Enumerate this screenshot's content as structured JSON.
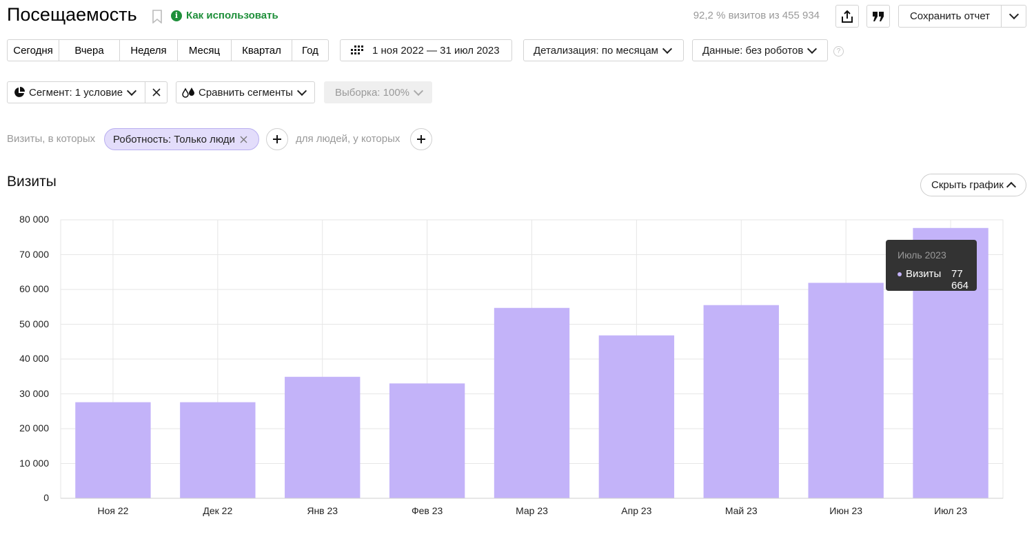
{
  "header": {
    "title": "Посещаемость",
    "help_link": "Как использовать",
    "visits_share": "92,2 % визитов из 455 934",
    "save_report": "Сохранить отчет"
  },
  "period_tabs": [
    "Сегодня",
    "Вчера",
    "Неделя",
    "Месяц",
    "Квартал",
    "Год"
  ],
  "date_range": "1 ноя 2022 — 31 июл 2023",
  "detail_dropdown": "Детализация: по месяцам",
  "data_dropdown": "Данные: без роботов",
  "segment": {
    "label": "Сегмент: 1 условие",
    "compare": "Сравнить сегменты",
    "sample": "Выборка: 100%"
  },
  "filters": {
    "visits_prefix": "Визиты, в которых",
    "chip": "Роботность: Только люди",
    "people_prefix": "для людей, у которых"
  },
  "chart_section": {
    "title": "Визиты",
    "hide_button": "Скрыть график"
  },
  "tooltip": {
    "period": "Июль 2023",
    "series": "Визиты",
    "value": "77 664"
  },
  "colors": {
    "bar": "#c3b3f9",
    "accent_green": "#1e8f3a",
    "tooltip_bg": "#333333"
  },
  "chart_data": {
    "type": "bar",
    "categories": [
      "Ноя 22",
      "Дек 22",
      "Янв 23",
      "Фев 23",
      "Мар 23",
      "Апр 23",
      "Май 23",
      "Июн 23",
      "Июл 23"
    ],
    "series": [
      {
        "name": "Визиты",
        "values": [
          27600,
          27600,
          34900,
          33000,
          54700,
          46800,
          55500,
          61900,
          77664
        ]
      }
    ],
    "ylim": [
      0,
      80000
    ],
    "yticks": [
      0,
      10000,
      20000,
      30000,
      40000,
      50000,
      60000,
      70000,
      80000
    ],
    "ytick_labels": [
      "0",
      "10 000",
      "20 000",
      "30 000",
      "40 000",
      "50 000",
      "60 000",
      "70 000",
      "80 000"
    ],
    "grid": true
  }
}
